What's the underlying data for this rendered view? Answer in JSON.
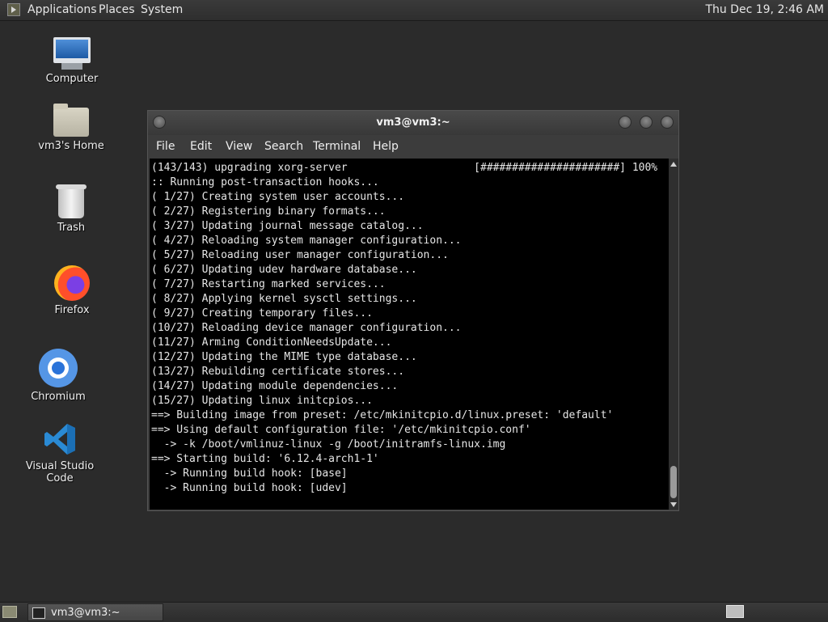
{
  "top_panel": {
    "menus": [
      "Applications",
      "Places",
      "System"
    ],
    "clock": "Thu Dec 19,  2:46 AM"
  },
  "desktop_icons": [
    {
      "label": "Computer",
      "icon": "computer-icon"
    },
    {
      "label": "vm3's Home",
      "icon": "home-folder-icon"
    },
    {
      "label": "Trash",
      "icon": "trash-icon"
    },
    {
      "label": "Firefox",
      "icon": "firefox-icon"
    },
    {
      "label": "Chromium",
      "icon": "chromium-icon"
    },
    {
      "label": "Visual Studio Code",
      "icon": "vscode-icon"
    }
  ],
  "terminal": {
    "title": "vm3@vm3:~",
    "menu": [
      "File",
      "Edit",
      "View",
      "Search",
      "Terminal",
      "Help"
    ],
    "lines": [
      "(143/143) upgrading xorg-server                    [######################] 100%",
      ":: Running post-transaction hooks...",
      "( 1/27) Creating system user accounts...",
      "( 2/27) Registering binary formats...",
      "( 3/27) Updating journal message catalog...",
      "( 4/27) Reloading system manager configuration...",
      "( 5/27) Reloading user manager configuration...",
      "( 6/27) Updating udev hardware database...",
      "( 7/27) Restarting marked services...",
      "( 8/27) Applying kernel sysctl settings...",
      "( 9/27) Creating temporary files...",
      "(10/27) Reloading device manager configuration...",
      "(11/27) Arming ConditionNeedsUpdate...",
      "(12/27) Updating the MIME type database...",
      "(13/27) Rebuilding certificate stores...",
      "(14/27) Updating module dependencies...",
      "(15/27) Updating linux initcpios...",
      "==> Building image from preset: /etc/mkinitcpio.d/linux.preset: 'default'",
      "==> Using default configuration file: '/etc/mkinitcpio.conf'",
      "  -> -k /boot/vmlinuz-linux -g /boot/initramfs-linux.img",
      "==> Starting build: '6.12.4-arch1-1'",
      "  -> Running build hook: [base]",
      "  -> Running build hook: [udev]"
    ]
  },
  "taskbar": {
    "task_label": "vm3@vm3:~"
  }
}
